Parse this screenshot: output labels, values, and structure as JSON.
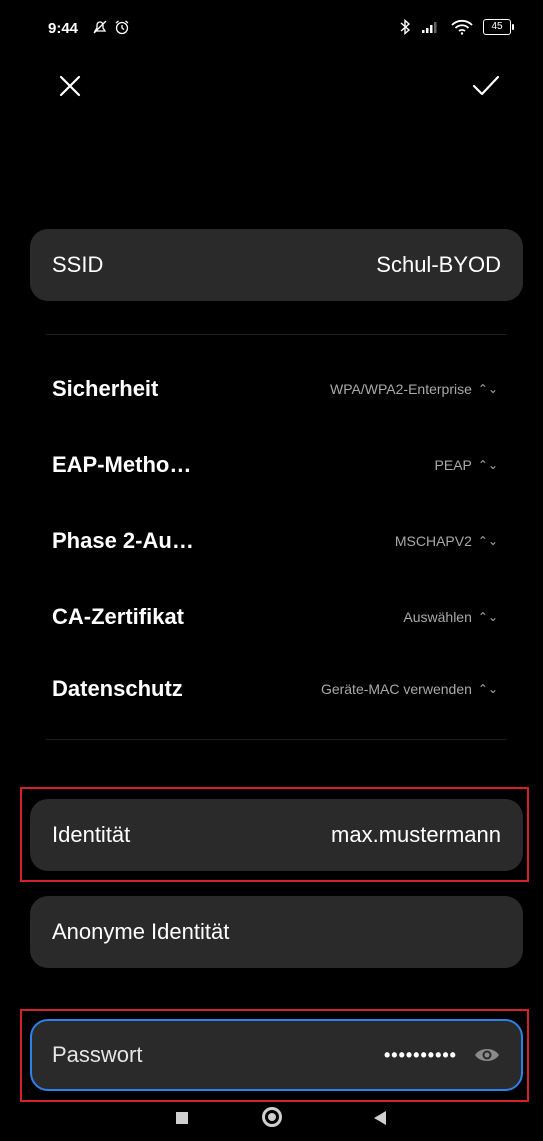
{
  "status_bar": {
    "time": "9:44",
    "battery": "45"
  },
  "header": {
    "close_icon": "close-icon",
    "confirm_icon": "check-icon"
  },
  "ssid": {
    "label": "SSID",
    "value": "Schul-BYOD"
  },
  "settings": [
    {
      "label": "Sicherheit",
      "value": "WPA/WPA2-Enterprise"
    },
    {
      "label": "EAP-Metho…",
      "value": "PEAP"
    },
    {
      "label": "Phase 2-Au…",
      "value": "MSCHAPV2"
    },
    {
      "label": "CA-Zertifikat",
      "value": "Auswählen"
    },
    {
      "label": "Datenschutz",
      "value": "Geräte-MAC verwenden"
    }
  ],
  "identity": {
    "label": "Identität",
    "value": "max.mustermann"
  },
  "anon_identity": {
    "label": "Anonyme Identität",
    "value": ""
  },
  "password": {
    "label": "Passwort",
    "masked_value": "••••••••••"
  },
  "colors": {
    "background": "#000000",
    "card": "#2a2a2a",
    "focus_border": "#2a82ea",
    "highlight_box": "#d42028",
    "secondary_text": "#a9a9a9"
  }
}
